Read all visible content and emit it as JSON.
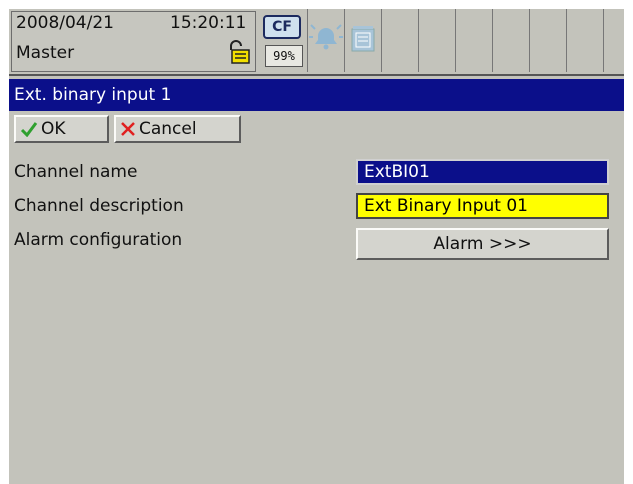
{
  "status": {
    "date": "2008/04/21",
    "time": "15:20:11",
    "user": "Master",
    "storage_label": "CF",
    "storage_percent": "99%"
  },
  "window": {
    "title": "Ext. binary input 1"
  },
  "toolbar": {
    "ok_label": "OK",
    "cancel_label": "Cancel"
  },
  "form": {
    "channel_name_label": "Channel name",
    "channel_name_value": "ExtBI01",
    "channel_description_label": "Channel description",
    "channel_description_value": "Ext Binary Input 01",
    "alarm_configuration_label": "Alarm configuration",
    "alarm_button_label": "Alarm >>>"
  },
  "colors": {
    "title_bar": "#0b0f8a",
    "background": "#c3c3bb",
    "selected_field": "#0b0f8a",
    "edit_field": "#ffff00",
    "ok_check": "#2fa02f",
    "cancel_x": "#e02020"
  },
  "icons": [
    "lock-open-icon",
    "cf-card-icon",
    "alarm-bell-icon",
    "document-icon",
    "check-icon",
    "x-icon"
  ]
}
